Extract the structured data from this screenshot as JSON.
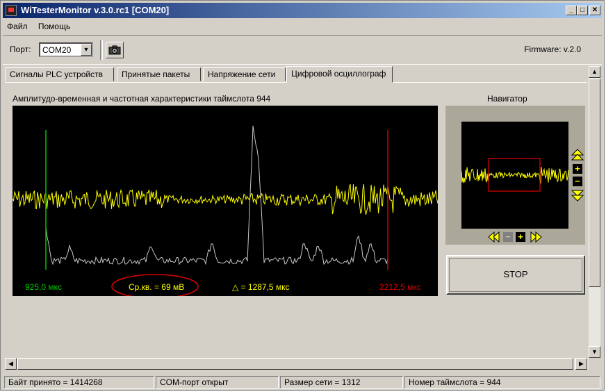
{
  "window": {
    "title": "WiTesterMonitor v.3.0.rc1 [COM20]",
    "controls": {
      "minimize": "_",
      "maximize": "□",
      "close": "✕"
    }
  },
  "menu": {
    "items": [
      "Файл",
      "Помощь"
    ]
  },
  "toolbar": {
    "port_label": "Порт:",
    "port_value": "COM20",
    "camera_icon": "camera-icon",
    "firmware": "Firmware: v.2.0"
  },
  "tabs": [
    {
      "label": "Сигналы PLC устройств",
      "active": false
    },
    {
      "label": "Принятые пакеты",
      "active": false
    },
    {
      "label": "Напряжение сети",
      "active": false
    },
    {
      "label": "Цифровой осциллограф",
      "active": true
    }
  ],
  "scope": {
    "title": "Амплитудо-временная и частотная характеристики таймслота 944",
    "cursor_left": "925,0 мкс",
    "rms": "Ср.кв. = 69 мВ",
    "delta": "△ = 1287,5 мкс",
    "cursor_right": "2212,5 мкс",
    "colors": {
      "signal": "#ffff00",
      "spectrum": "#c8c8c8",
      "left_cursor": "#00c800",
      "right_cursor": "#e00000",
      "annotation": "#e00000"
    }
  },
  "navigator": {
    "title": "Навигатор",
    "zoom_up_icon": "double-up-arrow-icon",
    "zoom_in": "+",
    "zoom_out": "−",
    "zoom_down_icon": "double-down-arrow-icon",
    "pan_left_icon": "double-left-arrow-icon",
    "h_minus": "−",
    "h_plus": "+",
    "pan_right_icon": "double-right-arrow-icon"
  },
  "stop_button": "STOP",
  "statusbar": [
    "Байт принято = 1414268",
    "COM-порт открыт",
    "Размер сети = 1312",
    "Номер таймслота = 944"
  ]
}
